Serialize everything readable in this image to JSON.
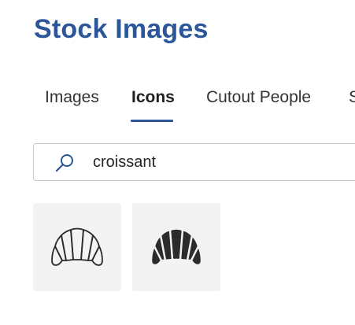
{
  "header": {
    "title": "Stock Images"
  },
  "tabs": [
    {
      "label": "Images",
      "active": false
    },
    {
      "label": "Icons",
      "active": true
    },
    {
      "label": "Cutout People",
      "active": false
    },
    {
      "label": "S",
      "active": false
    }
  ],
  "search": {
    "value": "croissant",
    "icon": "search-icon"
  },
  "results": [
    {
      "icon": "croissant-outline-icon"
    },
    {
      "icon": "croissant-filled-icon"
    }
  ],
  "colors": {
    "accent": "#2b579a",
    "tile_background": "#f3f3f3",
    "icon_dark": "#2b2b2b"
  }
}
